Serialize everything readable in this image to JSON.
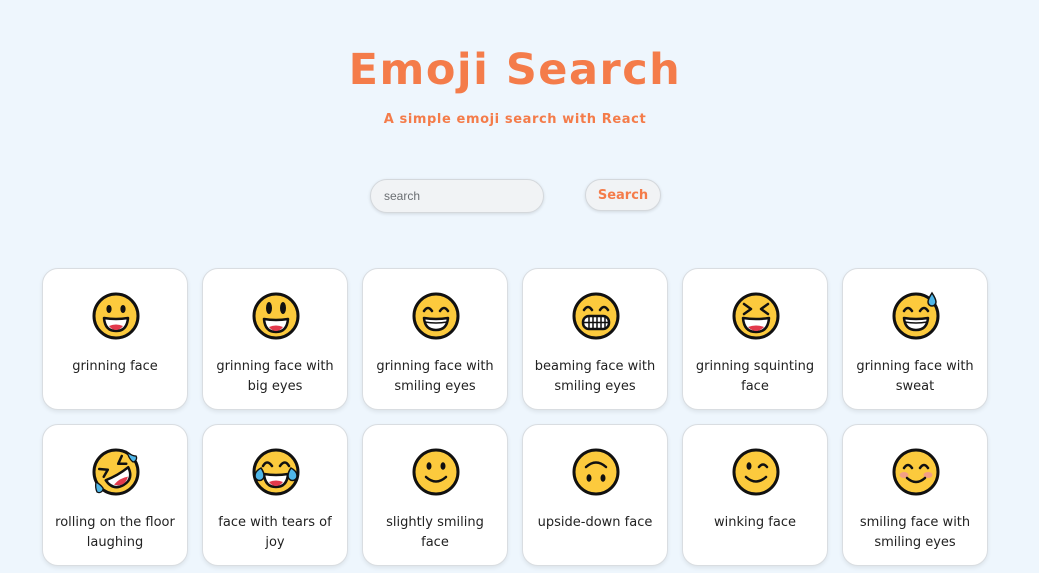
{
  "header": {
    "title": "Emoji Search",
    "subtitle": "A simple emoji search with React"
  },
  "search": {
    "placeholder": "search",
    "value": "",
    "button_label": "Search"
  },
  "colors": {
    "accent": "#f47c4a",
    "background": "#eef6fd",
    "emoji_yellow": "#fcca3d",
    "emoji_outline": "#111111"
  },
  "emojis": [
    {
      "label": "grinning face",
      "icon": "grinning-face-icon"
    },
    {
      "label": "grinning face with big eyes",
      "icon": "grinning-face-big-eyes-icon"
    },
    {
      "label": "grinning face with smiling eyes",
      "icon": "grinning-face-smiling-eyes-icon"
    },
    {
      "label": "beaming face with smiling eyes",
      "icon": "beaming-face-icon"
    },
    {
      "label": "grinning squinting face",
      "icon": "grinning-squinting-face-icon"
    },
    {
      "label": "grinning face with sweat",
      "icon": "grinning-face-sweat-icon"
    },
    {
      "label": "rolling on the floor laughing",
      "icon": "rolling-laughing-icon"
    },
    {
      "label": "face with tears of joy",
      "icon": "tears-of-joy-icon"
    },
    {
      "label": "slightly smiling face",
      "icon": "slightly-smiling-face-icon"
    },
    {
      "label": "upside-down face",
      "icon": "upside-down-face-icon"
    },
    {
      "label": "winking face",
      "icon": "winking-face-icon"
    },
    {
      "label": "smiling face with smiling eyes",
      "icon": "smiling-face-smiling-eyes-icon"
    }
  ]
}
